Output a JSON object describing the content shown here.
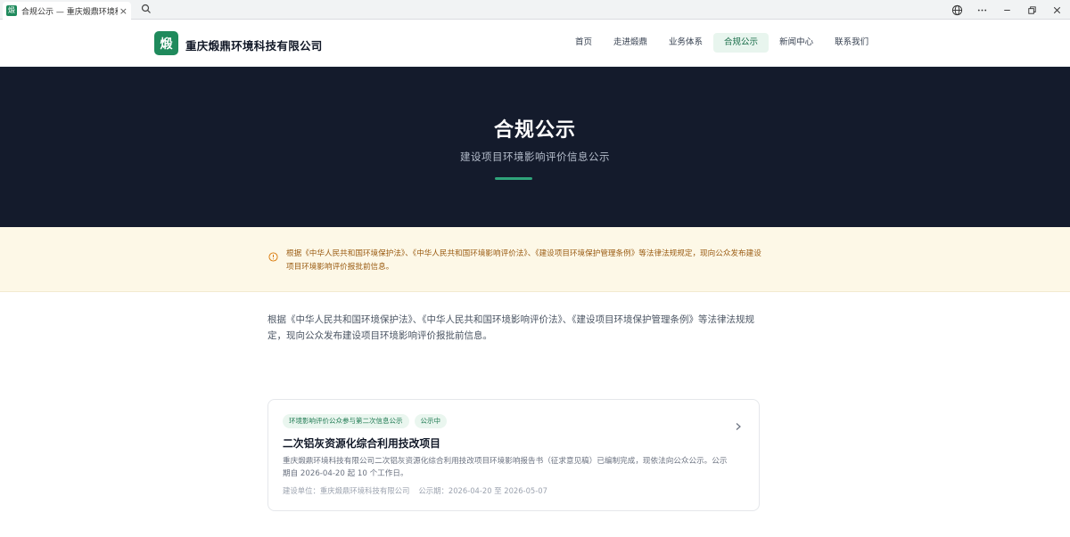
{
  "browser": {
    "tab_favicon": "煅",
    "tab_title": "合规公示 — 重庆煅鼎环境科技有限公司",
    "tab_close": "×"
  },
  "header": {
    "logo_mark": "煅",
    "company_name": "重庆煅鼎环境科技有限公司",
    "nav": [
      {
        "label": "首页"
      },
      {
        "label": "走进煅鼎"
      },
      {
        "label": "业务体系"
      },
      {
        "label": "合规公示"
      },
      {
        "label": "新闻中心"
      },
      {
        "label": "联系我们"
      }
    ]
  },
  "hero": {
    "title": "合规公示",
    "subtitle": "建设项目环境影响评价信息公示"
  },
  "notice": {
    "text": "根据《中华人民共和国环境保护法》、《中华人民共和国环境影响评价法》、《建设项目环境保护管理条例》等法律法规规定，现向公众发布建设项目环境影响评价报批前信息。"
  },
  "intro": {
    "text": "根据《中华人民共和国环境保护法》、《中华人民共和国环境影响评价法》、《建设项目环境保护管理条例》等法律法规规定，现向公众发布建设项目环境影响评价报批前信息。"
  },
  "card": {
    "tag_type": "环境影响评价公众参与第二次信息公示",
    "tag_status": "公示中",
    "title": "二次铝灰资源化综合利用技改项目",
    "description": "重庆煅鼎环境科技有限公司二次铝灰资源化综合利用技改项目环境影响报告书（征求意见稿）已编制完成，现依法向公众公示。公示期自 2026-04-20 起 10 个工作日。",
    "builder": "建设单位：重庆煅鼎环境科技有限公司",
    "period": "公示期：2026-04-20 至 2026-05-07"
  },
  "colors": {
    "brand": "#1f8a5c",
    "hero_bg": "#141b2c",
    "notice_bg": "#fdf8e7",
    "notice_text": "#9a5b12"
  }
}
